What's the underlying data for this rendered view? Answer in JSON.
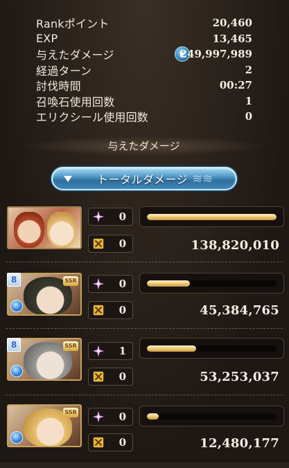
{
  "stats": [
    {
      "label": "Rankポイント",
      "value": "20,460"
    },
    {
      "label": "EXP",
      "value": "13,465"
    },
    {
      "label": "与えたダメージ",
      "value": "249,997,989"
    },
    {
      "label": "経過ターン",
      "value": "2"
    },
    {
      "label": "討伐時間",
      "value": "00:27"
    },
    {
      "label": "召喚石使用回数",
      "value": "1"
    },
    {
      "label": "エリクシール使用回数",
      "value": "0"
    }
  ],
  "section_title": "与えたダメージ",
  "damage_toggle_label": "トータルダメージ",
  "characters": [
    {
      "name": "main-character",
      "rarity_badge": "",
      "element_badge": "",
      "skill_count": "0",
      "ougi_count": "0",
      "damage": "138,820,010",
      "bar_fraction": 1.0
    },
    {
      "name": "character-2",
      "rarity_badge": "SSR",
      "element_badge": "8",
      "skill_count": "0",
      "ougi_count": "0",
      "damage": "45,384,765",
      "bar_fraction": 0.33
    },
    {
      "name": "character-3",
      "rarity_badge": "SSR",
      "element_badge": "8",
      "skill_count": "1",
      "ougi_count": "0",
      "damage": "53,253,037",
      "bar_fraction": 0.38
    },
    {
      "name": "character-4",
      "rarity_badge": "SSR",
      "element_badge": "",
      "skill_count": "0",
      "ougi_count": "0",
      "damage": "12,480,177",
      "bar_fraction": 0.09
    }
  ],
  "colors": {
    "accent": "#f0c870",
    "button": "#3f87b8",
    "background": "#2a221c"
  }
}
